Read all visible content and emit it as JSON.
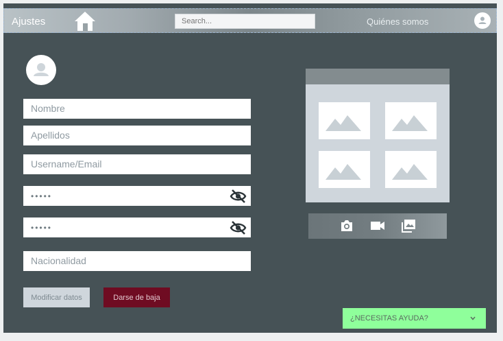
{
  "header": {
    "title": "Ajustes",
    "search_placeholder": "Search...",
    "about_link": "Quiénes somos"
  },
  "form": {
    "fields": [
      {
        "placeholder": "Nombre"
      },
      {
        "placeholder": "Apellidos"
      },
      {
        "placeholder": "Username/Email"
      },
      {
        "value": "•••••"
      },
      {
        "value": "•••••"
      },
      {
        "placeholder": "Nacionalidad"
      }
    ],
    "modify_button": "Modificar datos",
    "unsubscribe_button": "Darse de baja"
  },
  "media": {
    "tools": [
      "camera-icon",
      "video-icon",
      "photo-library-icon"
    ]
  },
  "help": {
    "label": "¿NECESITAS AYUDA?"
  },
  "colors": {
    "background": "#465256",
    "danger_button": "#6f0c22",
    "help_bar": "#8fff9b"
  }
}
